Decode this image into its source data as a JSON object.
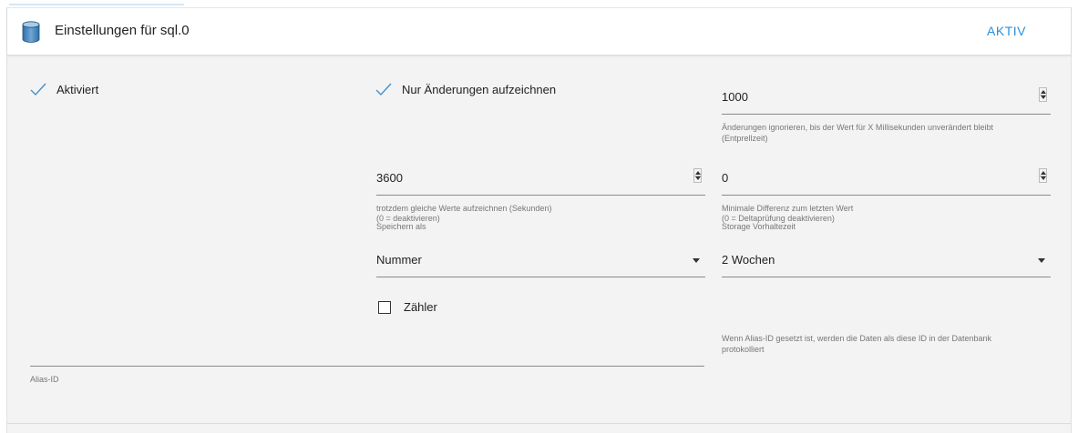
{
  "header": {
    "title": "Einstellungen für sql.0",
    "status": "AKTIV"
  },
  "checkboxes": {
    "aktiviert": {
      "label": "Aktiviert",
      "checked": true
    },
    "nur_aenderungen": {
      "label": "Nur Änderungen aufzeichnen",
      "checked": true
    },
    "zaehler": {
      "label": "Zähler",
      "checked": false
    }
  },
  "fields": {
    "debounce": {
      "value": "1000",
      "helper_line1": "Änderungen ignorieren, bis der Wert für X Millisekunden unverändert bleibt",
      "helper_line2": "(Entprellzeit)"
    },
    "same_values": {
      "value": "3600",
      "helper_line1": "trotzdem gleiche Werte aufzeichnen (Sekunden)",
      "helper_line2": "(0 = deaktivieren)"
    },
    "min_diff": {
      "value": "0",
      "helper_line1": "Minimale Differenz zum letzten Wert",
      "helper_line2": "(0 = Deltaprüfung deaktivieren)"
    },
    "store_as": {
      "label": "Speichern als",
      "value": "Nummer"
    },
    "retention": {
      "label": "Storage Vorhaltezeit",
      "value": "2 Wochen"
    },
    "alias": {
      "label": "Alias-ID",
      "value": "",
      "helper_line1": "Wenn Alias-ID gesetzt ist, werden die Daten als diese ID in der Datenbank",
      "helper_line2": "protokolliert"
    }
  },
  "colors": {
    "accent": "#2a8fd8",
    "check": "#4a90c8"
  },
  "icons": {
    "header_icon": "database-icon",
    "check_icon": "checkmark-icon",
    "spinner_icon": "number-spinner-icon",
    "dropdown_icon": "caret-down-icon"
  }
}
